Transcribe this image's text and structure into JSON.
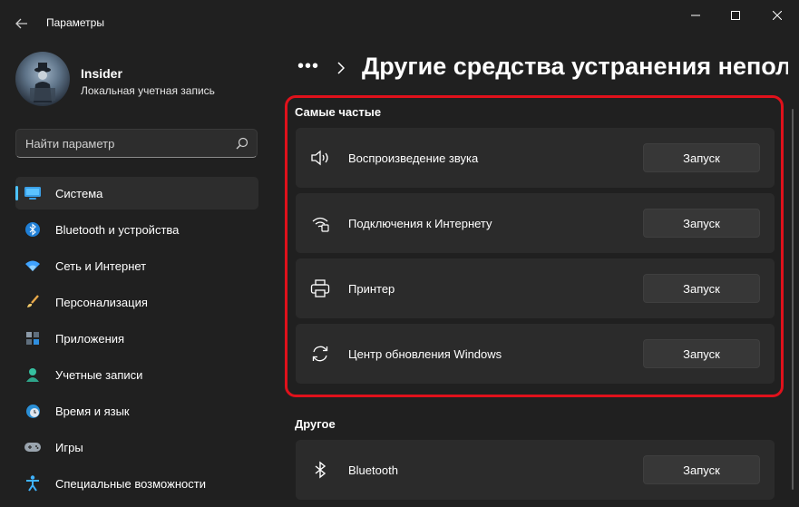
{
  "window": {
    "title": "Параметры"
  },
  "profile": {
    "name": "Insider",
    "subtitle": "Локальная учетная запись"
  },
  "search": {
    "placeholder": "Найти параметр"
  },
  "sidebar": {
    "items": [
      {
        "label": "Система",
        "icon": "system-icon",
        "active": true
      },
      {
        "label": "Bluetooth и устройства",
        "icon": "bluetooth-icon"
      },
      {
        "label": "Сеть и Интернет",
        "icon": "wifi-icon"
      },
      {
        "label": "Персонализация",
        "icon": "brush-icon"
      },
      {
        "label": "Приложения",
        "icon": "apps-icon"
      },
      {
        "label": "Учетные записи",
        "icon": "person-icon"
      },
      {
        "label": "Время и язык",
        "icon": "globe-clock-icon"
      },
      {
        "label": "Игры",
        "icon": "gamepad-icon"
      },
      {
        "label": "Специальные возможности",
        "icon": "accessibility-icon"
      }
    ]
  },
  "header": {
    "breadcrumb_overflow": "•••",
    "title": "Другие средства устранения непола"
  },
  "sections": [
    {
      "title": "Самые частые",
      "items": [
        {
          "label": "Воспроизведение звука",
          "icon": "speaker-icon",
          "button": "Запуск"
        },
        {
          "label": "Подключения к Интернету",
          "icon": "network-icon",
          "button": "Запуск"
        },
        {
          "label": "Принтер",
          "icon": "printer-icon",
          "button": "Запуск"
        },
        {
          "label": "Центр обновления Windows",
          "icon": "sync-icon",
          "button": "Запуск"
        }
      ]
    },
    {
      "title": "Другое",
      "items": [
        {
          "label": "Bluetooth",
          "icon": "bluetooth-icon",
          "button": "Запуск"
        }
      ]
    }
  ],
  "colors": {
    "accent": "#4cc2ff",
    "highlight": "#e0111b",
    "background": "#202020",
    "card": "#2b2b2b"
  }
}
